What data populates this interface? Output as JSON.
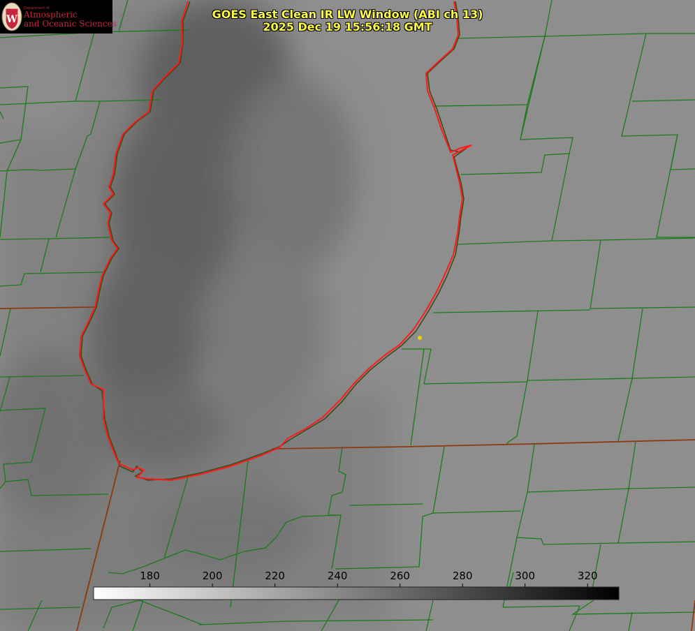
{
  "logo": {
    "department": "Department of",
    "line1": "Atmospheric",
    "line2": "and Oceanic Sciences",
    "seal_letter": "W"
  },
  "title": {
    "line1": "GOES East Clean IR LW Window (ABI ch 13)",
    "line2": "2025 Dec 19 15:56:18 GMT"
  },
  "colorbar": {
    "ticks": [
      "180",
      "200",
      "220",
      "240",
      "260",
      "280",
      "300",
      "320"
    ],
    "range": [
      162,
      330
    ],
    "gradient_start": "#ffffff",
    "gradient_end": "#000000"
  },
  "colors": {
    "shoreline": "#ff1a1a",
    "county_borders": "#1a7a1a",
    "state_border": "#8a3a10",
    "title_text": "#ffff44",
    "marker": "#e6d000"
  }
}
